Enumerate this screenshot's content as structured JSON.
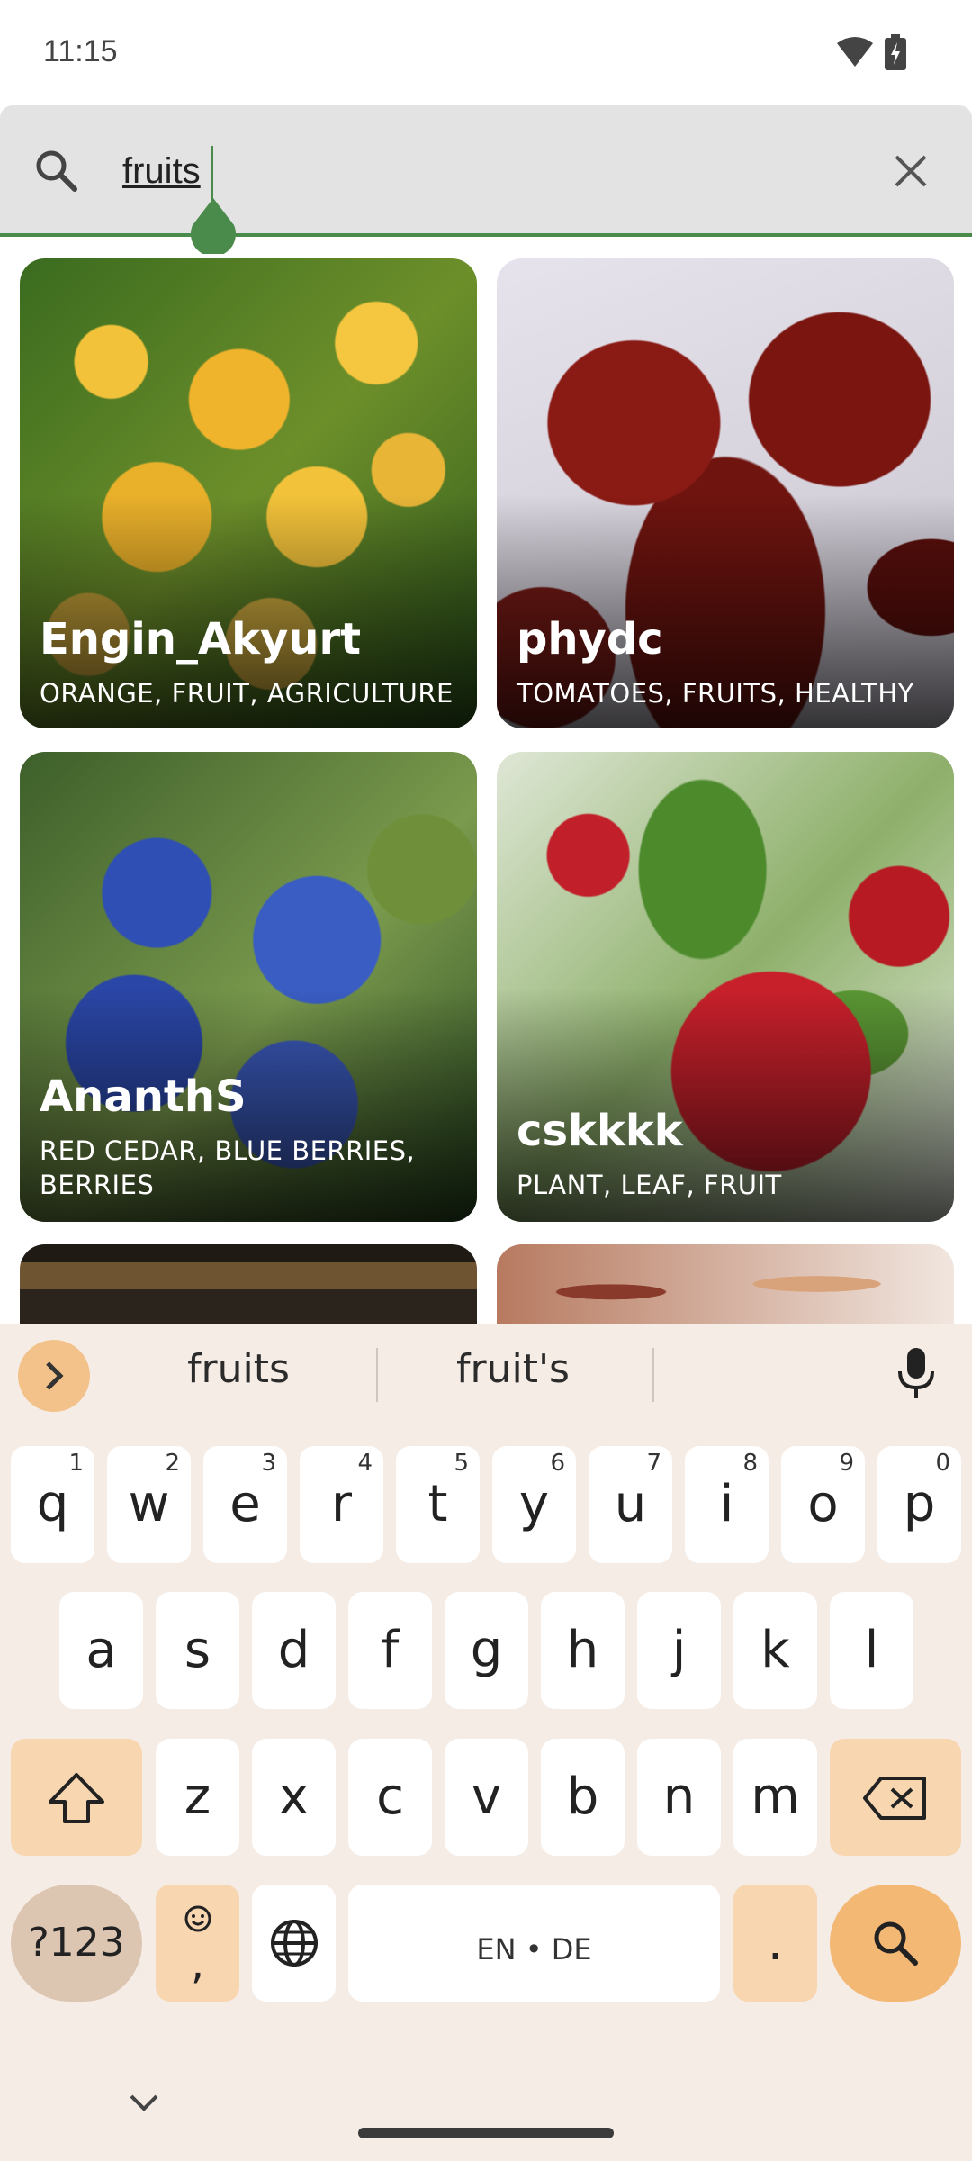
{
  "status_bar": {
    "time": "11:15",
    "icons": [
      "wifi-icon",
      "battery-charging-icon"
    ]
  },
  "search": {
    "query": "fruits",
    "icons": [
      "search-icon",
      "close-icon"
    ],
    "accent": "#4a8a4a"
  },
  "results": [
    {
      "author": "Engin_Akyurt",
      "tags": "ORANGE, FRUIT, AGRICULTURE"
    },
    {
      "author": "phydc",
      "tags": "TOMATOES, FRUITS, HEALTHY"
    },
    {
      "author": "AnanthS",
      "tags": "RED CEDAR, BLUE BERRIES, BERRIES"
    },
    {
      "author": "cskkkk",
      "tags": "PLANT, LEAF, FRUIT"
    }
  ],
  "keyboard": {
    "suggestions": [
      "fruits",
      "fruit's"
    ],
    "row1": [
      {
        "k": "q",
        "h": "1"
      },
      {
        "k": "w",
        "h": "2"
      },
      {
        "k": "e",
        "h": "3"
      },
      {
        "k": "r",
        "h": "4"
      },
      {
        "k": "t",
        "h": "5"
      },
      {
        "k": "y",
        "h": "6"
      },
      {
        "k": "u",
        "h": "7"
      },
      {
        "k": "i",
        "h": "8"
      },
      {
        "k": "o",
        "h": "9"
      },
      {
        "k": "p",
        "h": "0"
      }
    ],
    "row2": [
      "a",
      "s",
      "d",
      "f",
      "g",
      "h",
      "j",
      "k",
      "l"
    ],
    "row3": [
      "z",
      "x",
      "c",
      "v",
      "b",
      "n",
      "m"
    ],
    "symbols_label": "?123",
    "comma": ",",
    "space_label": "EN • DE",
    "period": ".",
    "colors": {
      "background": "#f6ece6",
      "function_key": "#f7d6b0",
      "action_key": "#f3b874"
    }
  }
}
